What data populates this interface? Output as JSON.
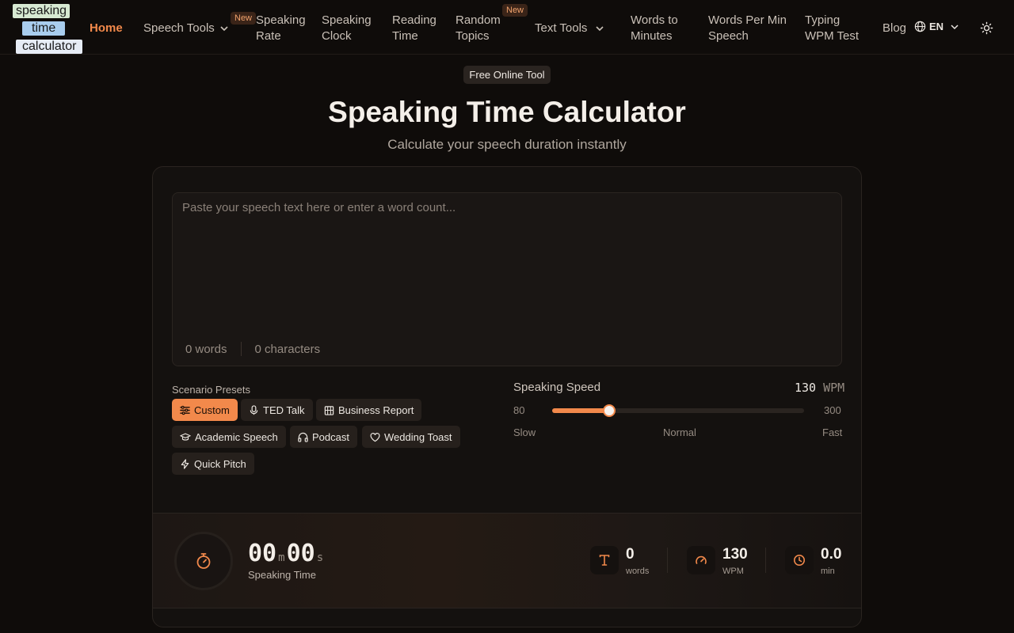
{
  "logo": {
    "line1": "speaking",
    "line2": "time",
    "line3": "calculator"
  },
  "nav": {
    "home": "Home",
    "speech_tools": "Speech Tools",
    "speaking_rate": [
      "Speaking",
      "Rate"
    ],
    "speaking_clock": [
      "Speaking",
      "Clock"
    ],
    "reading_time": [
      "Reading",
      "Time"
    ],
    "random_topics": [
      "Random",
      "Topics"
    ],
    "text_tools": "Text Tools",
    "words_to_minutes": [
      "Words to",
      "Minutes"
    ],
    "wpm_speech": [
      "Words Per Min",
      "Speech"
    ],
    "typing_test": [
      "Typing",
      "WPM Test"
    ],
    "blog": "Blog",
    "lang": "EN",
    "new_badge": "New"
  },
  "hero": {
    "pill": "Free Online Tool",
    "title": "Speaking Time Calculator",
    "subtitle": "Calculate your speech duration instantly"
  },
  "input": {
    "placeholder": "Paste your speech text here or enter a word count...",
    "words": "0 words",
    "characters": "0 characters"
  },
  "presets": {
    "label": "Scenario Presets",
    "items": [
      "Custom",
      "TED Talk",
      "Business Report",
      "Academic Speech",
      "Podcast",
      "Wedding Toast",
      "Quick Pitch"
    ]
  },
  "speed": {
    "label": "Speaking Speed",
    "value": 130,
    "value_text": "130",
    "unit": "WPM",
    "min": 80,
    "min_text": "80",
    "max": 300,
    "max_text": "300",
    "slow": "Slow",
    "normal": "Normal",
    "fast": "Fast"
  },
  "result": {
    "minutes": "00",
    "m_unit": "m",
    "seconds": "00",
    "s_unit": "s",
    "label": "Speaking Time",
    "stats": [
      {
        "value": "0",
        "label": "words"
      },
      {
        "value": "130",
        "label": "WPM"
      },
      {
        "value": "0.0",
        "label": "min"
      }
    ]
  },
  "colors": {
    "accent": "#f2894b",
    "background": "#0f0c0a",
    "card": "#14110f"
  }
}
